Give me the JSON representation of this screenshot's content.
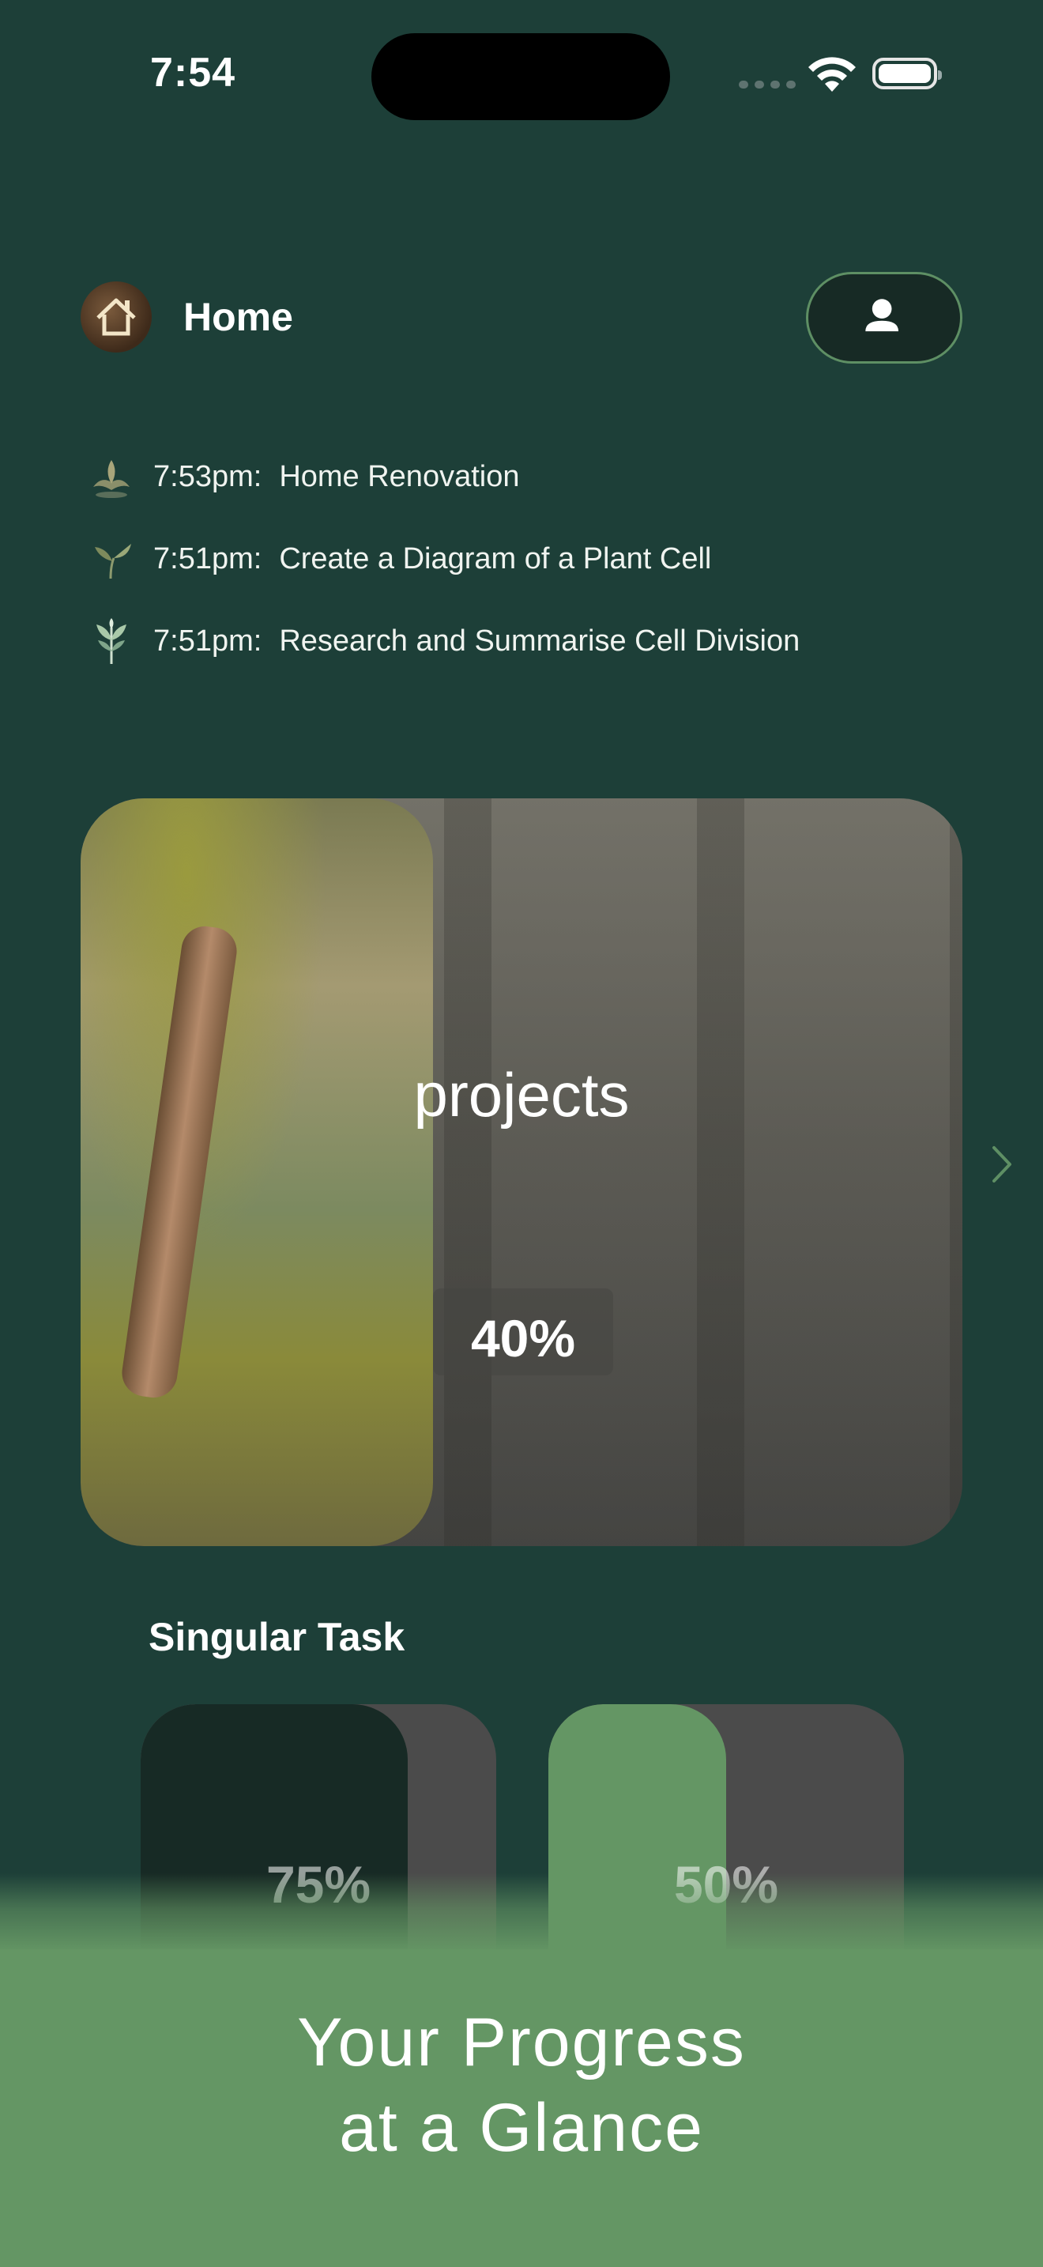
{
  "status_bar": {
    "time": "7:54"
  },
  "header": {
    "title": "Home"
  },
  "activity": [
    {
      "time": "7:53pm:",
      "title": "Home Renovation"
    },
    {
      "time": "7:51pm:",
      "title": "Create a Diagram of a Plant Cell"
    },
    {
      "time": "7:51pm:",
      "title": "Research and Summarise Cell Division"
    }
  ],
  "projects_card": {
    "label": "projects",
    "percent_text": "40%",
    "progress": 0.4
  },
  "singular_task": {
    "title": "Singular Task",
    "cards": [
      {
        "percent_text": "75%",
        "progress": 0.75,
        "color": "#172a25"
      },
      {
        "percent_text": "50%",
        "progress": 0.5,
        "color": "#649664"
      }
    ]
  },
  "banner": {
    "line1": "Your Progress",
    "line2": "at a Glance"
  },
  "colors": {
    "background": "#1d3f38",
    "accent": "#649664",
    "dark": "#172a25"
  }
}
